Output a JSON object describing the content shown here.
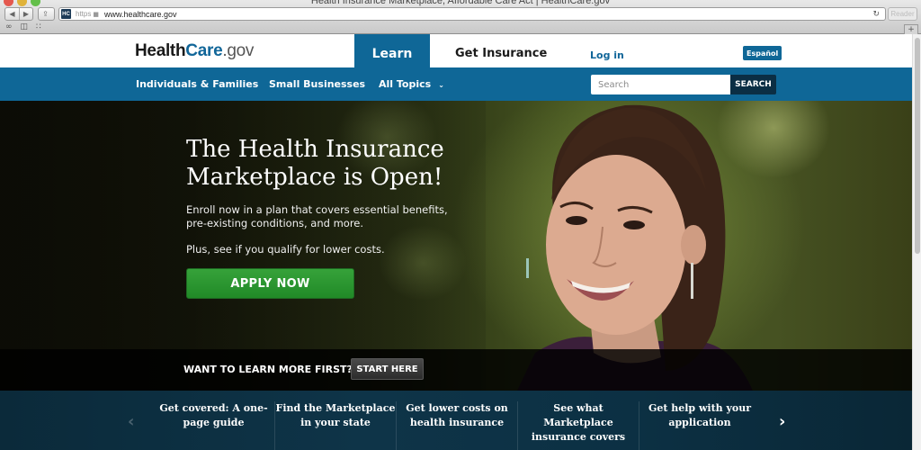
{
  "browser": {
    "window_title": "Health Insurance Marketplace, Affordable Care Act | HealthCare.gov",
    "scheme": "https",
    "url": "www.healthcare.gov",
    "favicon_text": "HC",
    "reader_label": "Reader",
    "icons": {
      "back": "◀",
      "forward": "▶",
      "share": "⇪",
      "lock": "🔒",
      "reload": "↻",
      "reading_list": "👓",
      "bookmarks": "📖",
      "top_sites": "▦",
      "new_tab": "+"
    }
  },
  "header": {
    "logo": {
      "part1": "Health",
      "part2": "Care",
      "part3": ".gov"
    },
    "tabs": [
      {
        "label": "Learn",
        "active": true
      },
      {
        "label": "Get Insurance",
        "active": false
      }
    ],
    "login_label": "Log in",
    "language_label": "Español"
  },
  "nav": {
    "items": [
      {
        "label": "Individuals & Families"
      },
      {
        "label": "Small Businesses"
      },
      {
        "label": "All Topics",
        "chevron": "⌄"
      }
    ],
    "search": {
      "placeholder": "Search",
      "value": "",
      "button_label": "SEARCH"
    }
  },
  "hero": {
    "title": "The Health Insurance Marketplace is Open!",
    "text1": "Enroll now in a plan that covers essential benefits, pre-existing conditions, and more.",
    "text2": "Plus, see if you qualify for lower costs.",
    "cta_label": "APPLY NOW",
    "learn_question": "WANT TO LEARN MORE FIRST?",
    "learn_button": "START HERE"
  },
  "carousel": {
    "prev_icon": "‹",
    "next_icon": "›",
    "items": [
      {
        "label": "Get covered: A one-page guide"
      },
      {
        "label": "Find the Marketplace in your state"
      },
      {
        "label": "Get lower costs on health insurance"
      },
      {
        "label": "See what Marketplace insurance covers"
      },
      {
        "label": "Get help with your application"
      }
    ]
  },
  "colors": {
    "brand_blue": "#0f6797",
    "search_button": "#0b2e44",
    "apply_green": "#2a962f",
    "carousel_bg": "#0e3448"
  }
}
